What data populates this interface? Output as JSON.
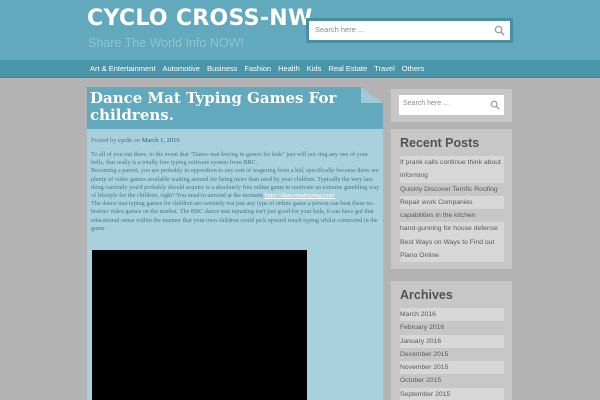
{
  "site": {
    "title": "CYCLO CROSS-NW",
    "tagline": "Share The World Info NOW!"
  },
  "header_search": {
    "placeholder": "Search here ..."
  },
  "nav": {
    "items": [
      "Art & Entertainment",
      "Automotive",
      "Business",
      "Fashion",
      "Health",
      "Kids",
      "Real Estate",
      "Travel",
      "Others"
    ]
  },
  "post": {
    "title": "Dance Mat Typing Games For childrens.",
    "meta_prefix": "Posted by",
    "author": "cycle",
    "meta_on": "on",
    "date": "March 1, 2016",
    "para1": "To all of you out there, in the event that \"Dance mat keying in games for kids\" just will not ring any one of your bells, that really is a totally free typing software system from BBC.",
    "para2": "Becoming a parent, you are probably in opposition to any sort of wagering from a kid, specifically because there are plenty of video games available waiting around for being more than used by your children. Typically the very last thing currently you'd probably should acquire is a absolutely free online game to motivate an extreme gambling way of lifestyle for the children, right? You need to unwind at the moment",
    "link": "https://dancemattyping.com/",
    "para3": "The dance mat typing games for children are certainly not just any type of online game a person can beat these no-brainer video games on the market. The BBC dance mat inputting isn't just good for your kids, it can have got that educational sense within the manner that your own children could pick upward touch typing whilst connected in the game."
  },
  "sidebar_search": {
    "placeholder": "Search here ..."
  },
  "recent_posts": {
    "title": "Recent Posts",
    "items": [
      "If prank calls continue think about informing",
      "Quickly Discover Terrific Roofing",
      "Repair work Companies",
      "capabilities in the kitchen",
      "hand-gunning for house defense",
      "Best Ways on Ways to Find out Piano Online"
    ]
  },
  "archives": {
    "title": "Archives",
    "items": [
      "March 2016",
      "February 2016",
      "January 2016",
      "December 2015",
      "November 2015",
      "October 2015",
      "September 2015"
    ]
  },
  "colors": {
    "header": "#62a9bd",
    "nav": "#4b95ab",
    "post_bg": "#a9d0dd",
    "page_bg": "#b3b3b3",
    "widget_bg": "#c7c7c7"
  }
}
